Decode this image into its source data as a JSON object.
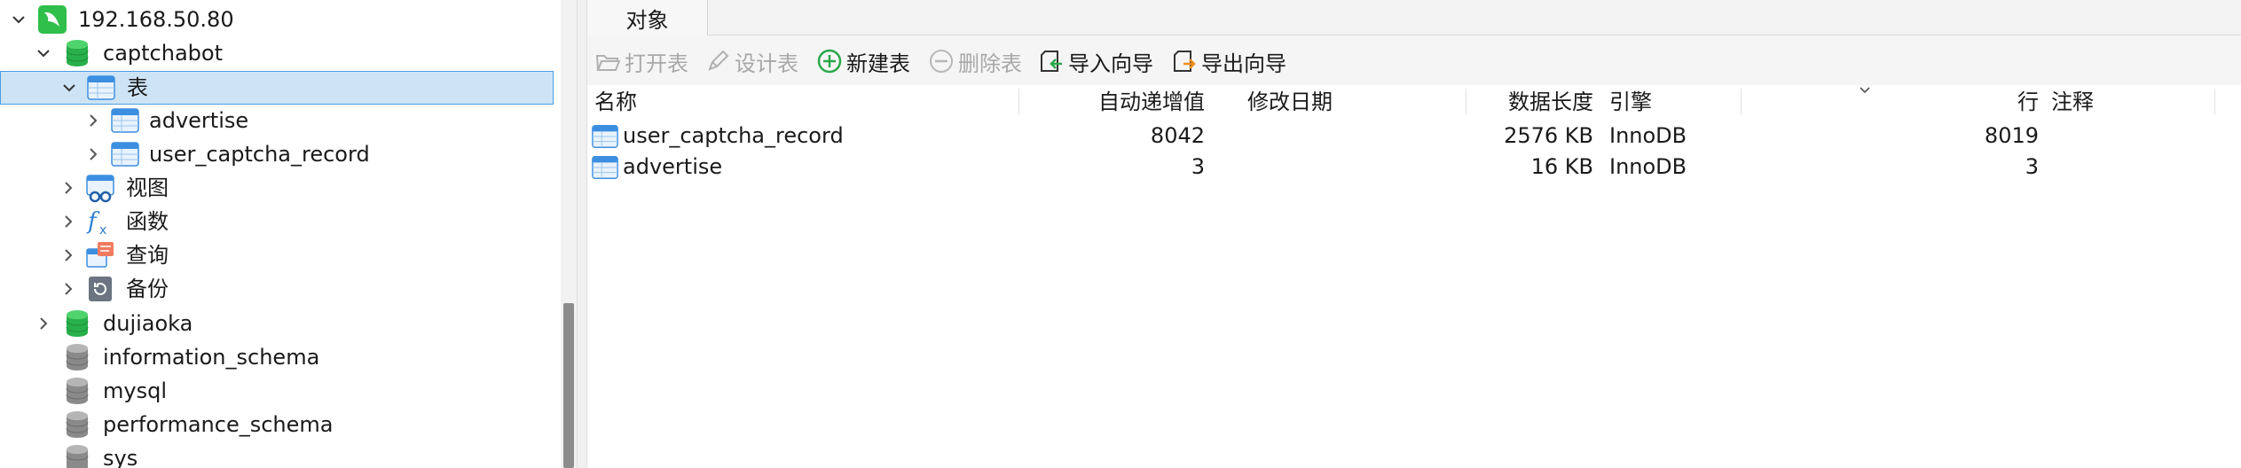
{
  "tree": {
    "connection": "192.168.50.80",
    "databases": [
      {
        "name": "captchabot"
      },
      {
        "name": "dujiaoka"
      },
      {
        "name": "information_schema"
      },
      {
        "name": "mysql"
      },
      {
        "name": "performance_schema"
      },
      {
        "name": "sys"
      }
    ],
    "groups": {
      "tables": "表",
      "views": "视图",
      "functions": "函数",
      "queries": "查询",
      "backups": "备份"
    },
    "tables": [
      "advertise",
      "user_captcha_record"
    ]
  },
  "tabs": [
    {
      "label": "对象"
    }
  ],
  "toolbar": {
    "open_table": "打开表",
    "design_table": "设计表",
    "new_table": "新建表",
    "delete_table": "删除表",
    "import_wizard": "导入向导",
    "export_wizard": "导出向导"
  },
  "grid": {
    "columns": {
      "name": "名称",
      "auto_increment": "自动递增值",
      "modified": "修改日期",
      "data_length": "数据长度",
      "engine": "引擎",
      "rows": "行",
      "comment": "注释"
    },
    "rows": [
      {
        "name": "user_captcha_record",
        "auto_increment": "8042",
        "modified": "",
        "data_length": "2576 KB",
        "engine": "InnoDB",
        "rows": "8019",
        "comment": ""
      },
      {
        "name": "advertise",
        "auto_increment": "3",
        "modified": "",
        "data_length": "16 KB",
        "engine": "InnoDB",
        "rows": "3",
        "comment": ""
      }
    ]
  },
  "colors": {
    "selection": "#cde4f7",
    "selection_border": "#4a9fe0",
    "connection_green": "#2fbf4a",
    "db_green": "#28b04a",
    "db_gray": "#8a8a8a",
    "table_blue": "#3c8ee0",
    "add_green": "#2aa84a"
  }
}
